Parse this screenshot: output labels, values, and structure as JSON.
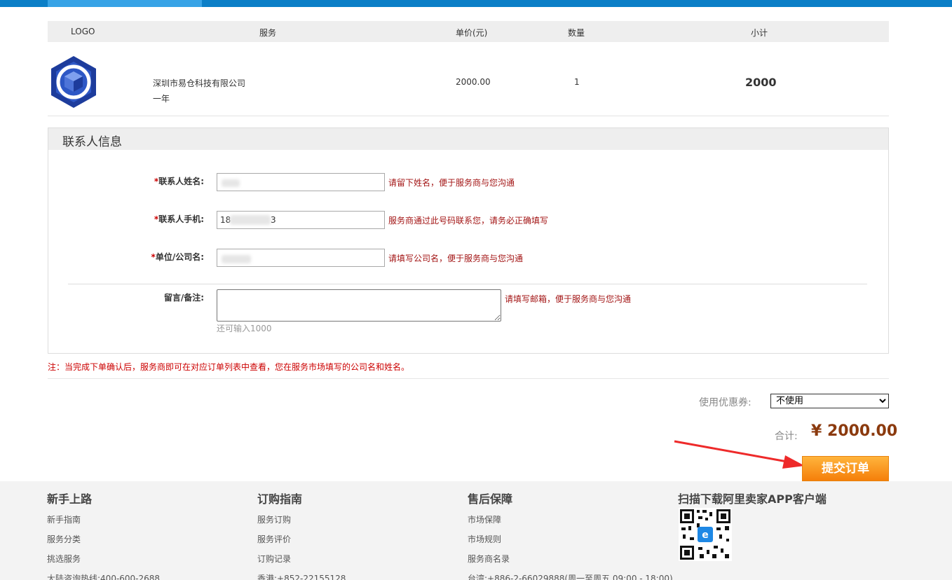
{
  "order_table": {
    "headers": [
      "LOGO",
      "服务",
      "单价(元)",
      "数量",
      "小计"
    ],
    "row": {
      "service_name": "深圳市易仓科技有限公司",
      "term": "一年",
      "unit_price": "2000.00",
      "quantity": "1",
      "subtotal": "2000"
    }
  },
  "contact": {
    "title": "联系人信息",
    "name_label": "联系人姓名:",
    "name_hint": "请留下姓名，便于服务商与您沟通",
    "phone_label": "联系人手机:",
    "phone_value": "18",
    "phone_tail": "3",
    "phone_hint": "服务商通过此号码联系您，请务必正确填写",
    "company_label": "单位/公司名:",
    "company_hint": "请填写公司名，便于服务商与您沟通",
    "remark_label": "留言/备注:",
    "remark_hint": "请填写邮箱，便于服务商与您沟通",
    "remaining": "还可输入1000",
    "required_mark": "*"
  },
  "note": "注：当完成下单确认后，服务商即可在对应订单列表中查看，您在服务市场填写的公司名和姓名。",
  "summary": {
    "coupon_label": "使用优惠券:",
    "coupon_selected": "不使用",
    "total_label": "合计:",
    "total_value": "¥ 2000.00",
    "submit_label": "提交订单"
  },
  "footer": {
    "col1": {
      "title": "新手上路",
      "links": [
        "新手指南",
        "服务分类",
        "挑选服务",
        "大陆咨询热线:400-600-2688"
      ]
    },
    "col2": {
      "title": "订购指南",
      "links": [
        "服务订购",
        "服务评价",
        "订购记录",
        "香港:+852-22155128"
      ]
    },
    "col3": {
      "title": "售后保障",
      "links": [
        "市场保障",
        "市场规则",
        "服务商名录",
        "台湾:+886-2-66029888(周一至周五 09:00 - 18:00)"
      ]
    },
    "col4": {
      "title": "扫描下载阿里卖家APP客户端"
    }
  },
  "colors": {
    "topbar": "#0b7fc7",
    "accent_orange": "#f57f0a",
    "hint_red": "#a31515",
    "total_brown": "#8b3a0e"
  },
  "icons": {
    "logo": "hexagon-logo-icon",
    "arrow": "red-arrow-icon",
    "qr": "qr-code-icon"
  }
}
